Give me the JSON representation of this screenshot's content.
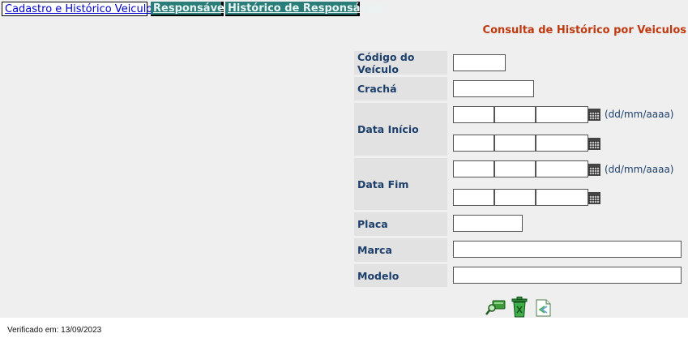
{
  "tabs": [
    {
      "label": "Cadastro e Histórico Veiculos"
    },
    {
      "label": "Responsáveis"
    },
    {
      "label": "Histórico de Responsáveis"
    }
  ],
  "page_title": "Consulta de Histórico por Veiculos",
  "form": {
    "codigo_veiculo": {
      "label": "Código do Veículo",
      "value": ""
    },
    "cracha": {
      "label": "Crachá",
      "value": ""
    },
    "data_inicio": {
      "label": "Data Início",
      "format_hint": "(dd/mm/aaaa)"
    },
    "data_fim": {
      "label": "Data Fim",
      "format_hint": "(dd/mm/aaaa)"
    },
    "placa": {
      "label": "Placa",
      "value": ""
    },
    "marca": {
      "label": "Marca",
      "value": ""
    },
    "modelo": {
      "label": "Modelo",
      "value": ""
    }
  },
  "actions": [
    {
      "icon": "search-icon"
    },
    {
      "icon": "clear-trash-icon"
    },
    {
      "icon": "back-document-icon"
    }
  ],
  "footer": {
    "verified_text": "Verificado em: 13/09/2023"
  },
  "colors": {
    "active_tab_text": "#0000cc",
    "inactive_tab_bg": "#2a7d79",
    "title": "#c0390f",
    "label_text": "#1d3f6b",
    "label_bg": "#e2e2e2",
    "panel_bg": "#efefef"
  }
}
